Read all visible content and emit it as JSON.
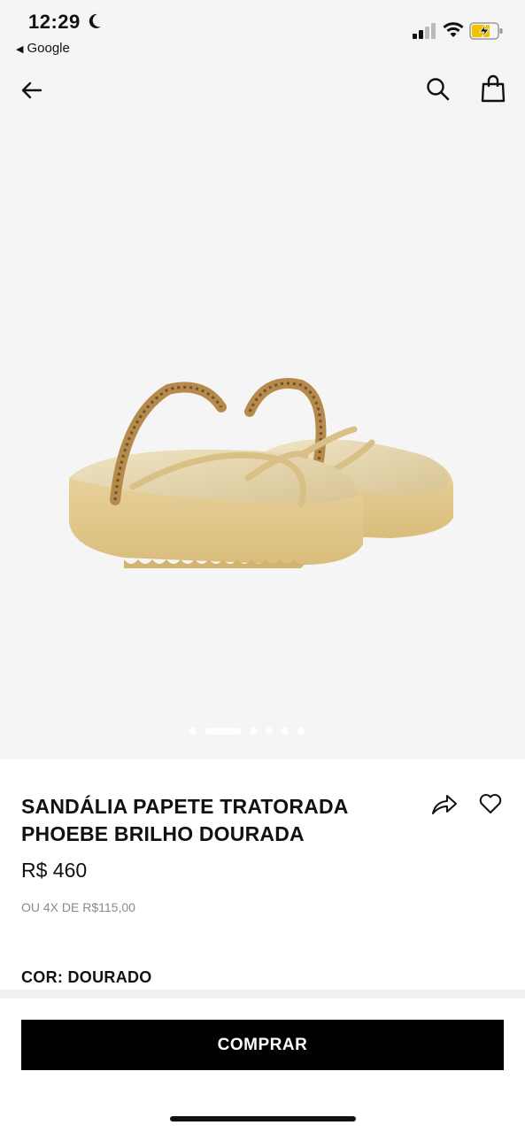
{
  "status": {
    "time": "12:29",
    "back_app": "Google"
  },
  "product": {
    "title": "SANDÁLIA PAPETE TRATORADA PHOEBE BRILHO DOURADA",
    "price": "R$ 460",
    "installments": "OU 4X DE R$115,00",
    "color_label": "COR: DOURADO",
    "image_count": 6,
    "active_image": 1
  },
  "actions": {
    "buy_label": "COMPRAR"
  },
  "icons": {
    "back": "arrow-left-icon",
    "search": "search-icon",
    "bag": "shopping-bag-icon",
    "share": "share-icon",
    "favorite": "heart-icon"
  }
}
